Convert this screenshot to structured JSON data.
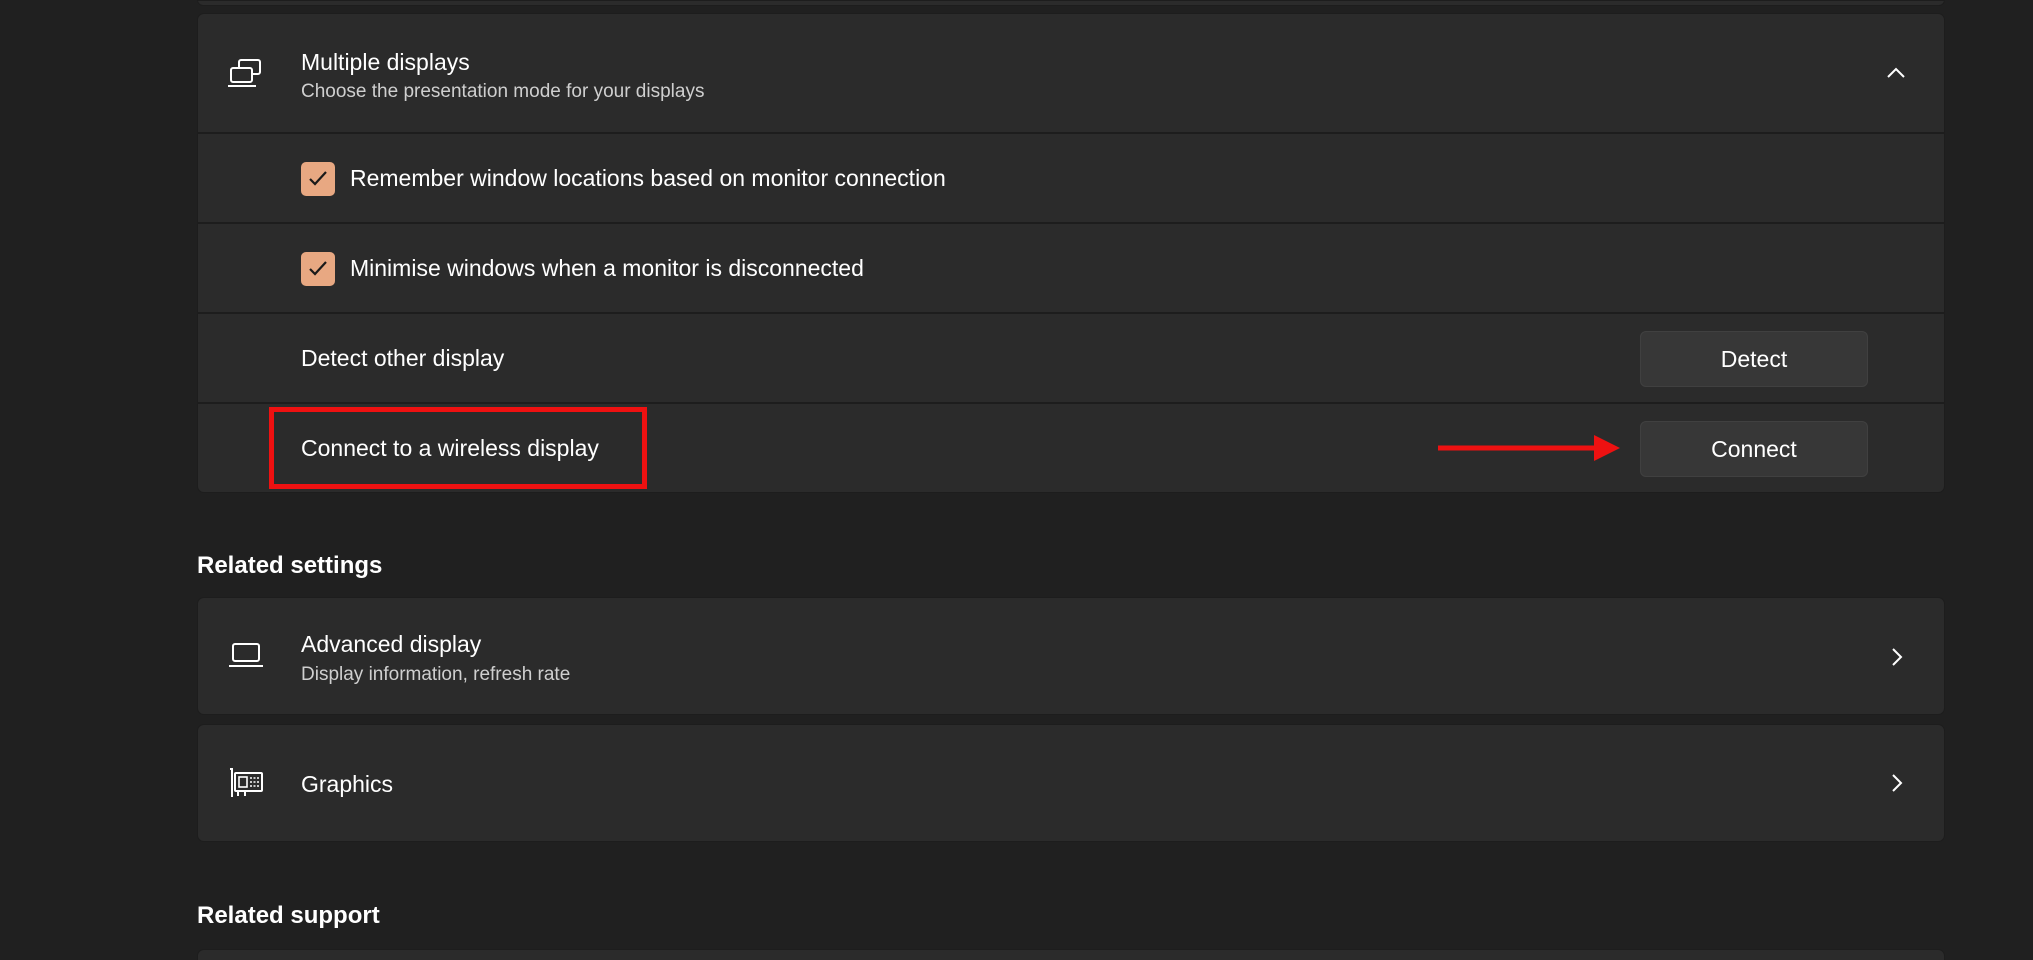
{
  "multiple_displays": {
    "title": "Multiple displays",
    "subtitle": "Choose the presentation mode for your displays",
    "icon": "multiple-displays-icon",
    "expanded": true
  },
  "options": {
    "remember_windows": {
      "label": "Remember window locations based on monitor connection",
      "checked": true
    },
    "minimise_windows": {
      "label": "Minimise windows when a monitor is disconnected",
      "checked": true
    }
  },
  "detect": {
    "label": "Detect other display",
    "button": "Detect"
  },
  "connect": {
    "label": "Connect to a wireless display",
    "button": "Connect"
  },
  "related_settings": {
    "heading": "Related settings",
    "advanced_display": {
      "title": "Advanced display",
      "subtitle": "Display information, refresh rate",
      "icon": "laptop-icon"
    },
    "graphics": {
      "title": "Graphics",
      "icon": "graphics-card-icon"
    }
  },
  "related_support": {
    "heading": "Related support"
  },
  "colors": {
    "background": "#202020",
    "card": "#2b2b2b",
    "checkbox_accent": "#e8a882",
    "annotation_red": "#ee1111",
    "button": "#373737"
  }
}
